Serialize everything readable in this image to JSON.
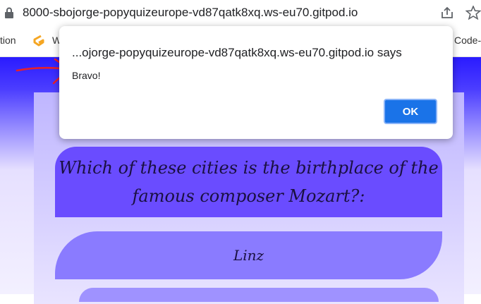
{
  "browser": {
    "url": "8000-sbojorge-popyquizeurope-vd87qatk8xq.ws-eu70.gitpod.io",
    "icons": [
      "lock-icon",
      "share-icon",
      "star-icon"
    ]
  },
  "bookmarks": {
    "left_label": "tion",
    "w_label": "W",
    "right_label": "Code-"
  },
  "dialog": {
    "title": "...ojorge-popyquizeurope-vd87qatk8xq.ws-eu70.gitpod.io says",
    "message": "Bravo!",
    "ok_label": "OK"
  },
  "quiz": {
    "question": "Which of these cities is the birthplace of the famous composer Mozart?:",
    "answers": [
      "Linz"
    ]
  },
  "colors": {
    "accent": "#1a73e8",
    "question_bg": "#6a4cff",
    "answer_bg": "#8a7bff",
    "annotation": "#e8202a"
  }
}
